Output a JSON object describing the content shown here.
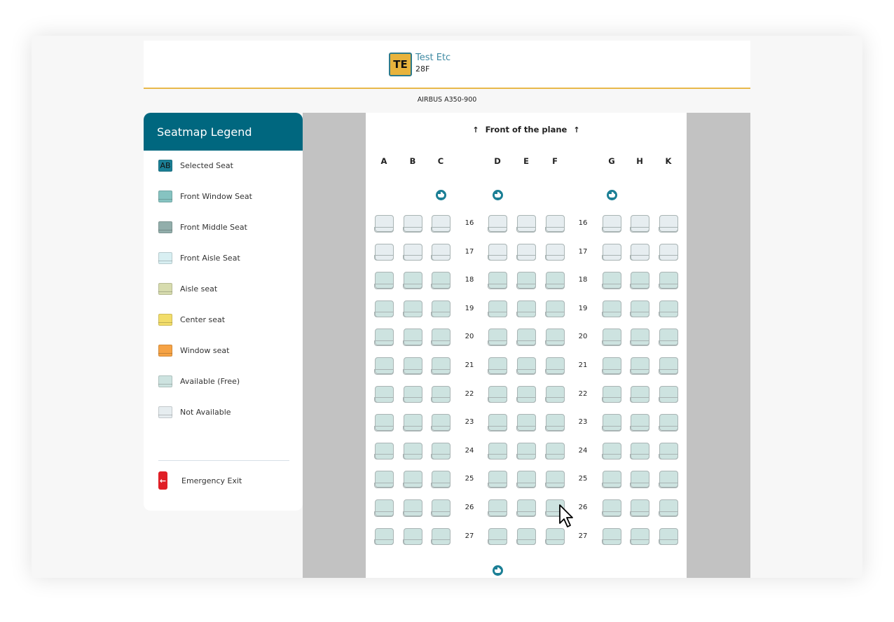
{
  "passenger": {
    "initials": "TE",
    "name": "Test Etc",
    "seat": "28F"
  },
  "aircraft": "AIRBUS A350-900",
  "colors": {
    "brand_teal": "#00677f",
    "accent_yellow": "#e8b84a",
    "exit_red": "#e01f26"
  },
  "legend": {
    "title": "Seatmap Legend",
    "items": [
      {
        "label": "Selected Seat",
        "swatch_text": "AB",
        "color": "#1b7f95",
        "icon": "selected-seat-icon"
      },
      {
        "label": "Front Window Seat",
        "color": "#86c3c1",
        "icon": "seat-icon"
      },
      {
        "label": "Front Middle Seat",
        "color": "#92aeab",
        "icon": "seat-icon"
      },
      {
        "label": "Front Aisle Seat",
        "color": "#d8eff2",
        "icon": "seat-icon"
      },
      {
        "label": "Aisle seat",
        "color": "#d7dcae",
        "icon": "seat-icon"
      },
      {
        "label": "Center seat",
        "color": "#f2dd6a",
        "icon": "seat-icon"
      },
      {
        "label": "Window seat",
        "color": "#f6a345",
        "icon": "seat-icon"
      },
      {
        "label": "Available (Free)",
        "color": "#cde3e0",
        "icon": "seat-icon"
      },
      {
        "label": "Not Available",
        "color": "#e6edf0",
        "icon": "seat-icon"
      }
    ],
    "emergency_exit": {
      "label": "Emergency Exit",
      "icon": "exit-arrow-left-icon",
      "glyph": "←"
    }
  },
  "seatmap": {
    "front_label": "Front of the plane",
    "arrow_glyph": "↑",
    "columns": [
      "A",
      "B",
      "C",
      "D",
      "E",
      "F",
      "G",
      "H",
      "K"
    ],
    "bassinet_top_columns": [
      "C",
      "D",
      "G"
    ],
    "bassinet_bottom_after": "D",
    "rows": [
      {
        "number": "16",
        "status": "not-available"
      },
      {
        "number": "17",
        "status": "not-available"
      },
      {
        "number": "18",
        "status": "available"
      },
      {
        "number": "19",
        "status": "available"
      },
      {
        "number": "20",
        "status": "available"
      },
      {
        "number": "21",
        "status": "available"
      },
      {
        "number": "22",
        "status": "available"
      },
      {
        "number": "23",
        "status": "available"
      },
      {
        "number": "24",
        "status": "available"
      },
      {
        "number": "25",
        "status": "available"
      },
      {
        "number": "26",
        "status": "available"
      },
      {
        "number": "27",
        "status": "available"
      }
    ]
  }
}
